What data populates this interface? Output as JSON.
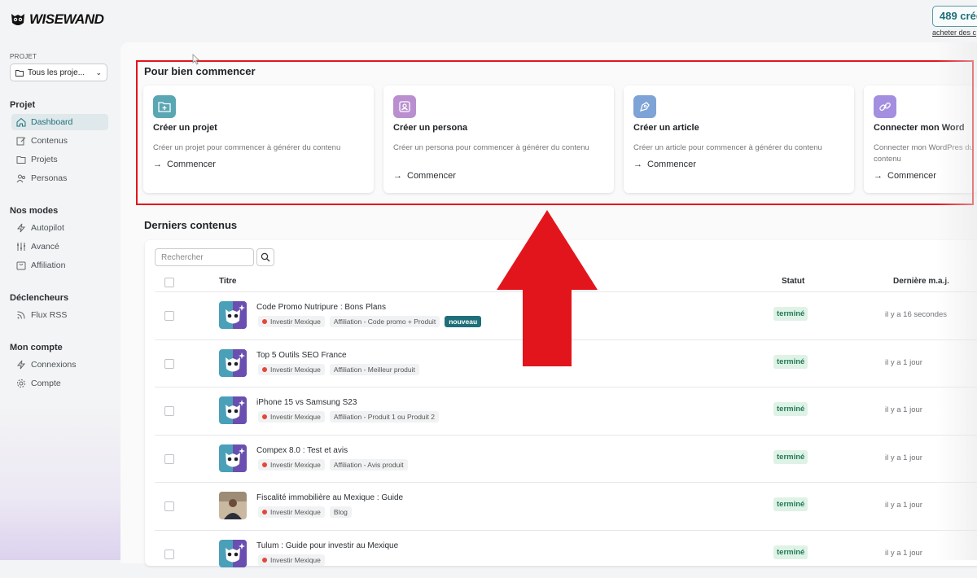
{
  "brand": {
    "name": "WISEWAND",
    "logo_icon": "owl-logo-icon"
  },
  "header": {
    "credits": "489 créd",
    "buy_link": "acheter des c"
  },
  "sidebar": {
    "project_label": "PROJET",
    "project_select": "Tous les proje...",
    "sections": [
      {
        "heading": "Projet",
        "items": [
          {
            "label": "Dashboard",
            "icon": "home-icon",
            "active": true
          },
          {
            "label": "Contenus",
            "icon": "edit-icon"
          },
          {
            "label": "Projets",
            "icon": "folder-icon"
          },
          {
            "label": "Personas",
            "icon": "users-icon"
          }
        ]
      },
      {
        "heading": "Nos modes",
        "items": [
          {
            "label": "Autopilot",
            "icon": "zap-icon"
          },
          {
            "label": "Avancé",
            "icon": "sliders-icon"
          },
          {
            "label": "Affiliation",
            "icon": "cart-icon"
          }
        ]
      },
      {
        "heading": "Déclencheurs",
        "items": [
          {
            "label": "Flux RSS",
            "icon": "rss-icon"
          }
        ]
      },
      {
        "heading": "Mon compte",
        "items": [
          {
            "label": "Connexions",
            "icon": "plug-icon"
          },
          {
            "label": "Compte",
            "icon": "settings-icon"
          }
        ]
      }
    ]
  },
  "getting_started": {
    "title": "Pour bien commencer",
    "cards": [
      {
        "title": "Créer un projet",
        "desc": "Créer un projet pour commencer à générer du contenu",
        "cta": "Commencer",
        "icon": "folder-plus-icon",
        "color": "#5aa6b3"
      },
      {
        "title": "Créer un persona",
        "desc": "Créer un persona pour commencer à générer du contenu",
        "cta": "Commencer",
        "icon": "user-card-icon",
        "color": "#b98fd0"
      },
      {
        "title": "Créer un article",
        "desc": "Créer un article pour commencer à générer du contenu",
        "cta": "Commencer",
        "icon": "pen-icon",
        "color": "#7ea3d6"
      },
      {
        "title": "Connecter mon Word",
        "desc": "Connecter mon WordPres du contenu",
        "cta": "Commencer",
        "icon": "link-icon",
        "color": "#a48ee0"
      }
    ]
  },
  "latest": {
    "title": "Derniers contenus",
    "search_placeholder": "Rechercher",
    "columns": {
      "title": "Titre",
      "status": "Statut",
      "updated": "Dernière m.a.j."
    },
    "rows": [
      {
        "title": "Code Promo Nutripure : Bons Plans",
        "project": "Investir Mexique",
        "type": "Affiliation - Code promo + Produit",
        "new": "nouveau",
        "status": "terminé",
        "updated": "il y a 16 secondes",
        "thumb": "owl"
      },
      {
        "title": "Top 5 Outils SEO France",
        "project": "Investir Mexique",
        "type": "Affiliation - Meilleur produit",
        "status": "terminé",
        "updated": "il y a 1 jour",
        "thumb": "owl"
      },
      {
        "title": "iPhone 15 vs Samsung S23",
        "project": "Investir Mexique",
        "type": "Affiliation - Produit 1 ou Produit 2",
        "status": "terminé",
        "updated": "il y a 1 jour",
        "thumb": "owl"
      },
      {
        "title": "Compex 8.0 : Test et avis",
        "project": "Investir Mexique",
        "type": "Affiliation - Avis produit",
        "status": "terminé",
        "updated": "il y a 1 jour",
        "thumb": "owl"
      },
      {
        "title": "Fiscalité immobilière au Mexique : Guide",
        "project": "Investir Mexique",
        "type": "Blog",
        "status": "terminé",
        "updated": "il y a 1 jour",
        "thumb": "photo"
      },
      {
        "title": "Tulum : Guide pour investir au Mexique",
        "project": "Investir Mexique",
        "type": "",
        "status": "terminé",
        "updated": "il y a 1 jour",
        "thumb": "owl"
      }
    ]
  },
  "annotation": {
    "highlight_color": "#e3151c",
    "arrow_color": "#e3151c"
  }
}
